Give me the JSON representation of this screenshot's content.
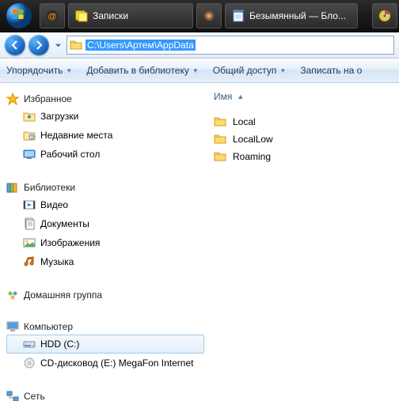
{
  "taskbar": {
    "items": [
      {
        "label": "Записки"
      },
      {
        "label": "Безымянный — Бло..."
      }
    ]
  },
  "address": {
    "path": "C:\\Users\\Артем\\AppData"
  },
  "toolbar": {
    "organize": "Упорядочить",
    "include": "Добавить в библиотеку",
    "share": "Общий доступ",
    "burn": "Записать на о"
  },
  "nav": {
    "favorites": {
      "label": "Избранное",
      "items": [
        "Загрузки",
        "Недавние места",
        "Рабочий стол"
      ]
    },
    "libraries": {
      "label": "Библиотеки",
      "items": [
        "Видео",
        "Документы",
        "Изображения",
        "Музыка"
      ]
    },
    "homegroup": {
      "label": "Домашняя группа"
    },
    "computer": {
      "label": "Компьютер",
      "items": [
        "HDD (C:)",
        "CD-дисковод (E:) MegaFon Internet"
      ]
    },
    "network": {
      "label": "Сеть"
    }
  },
  "content": {
    "header": "Имя",
    "folders": [
      "Local",
      "LocalLow",
      "Roaming"
    ]
  }
}
